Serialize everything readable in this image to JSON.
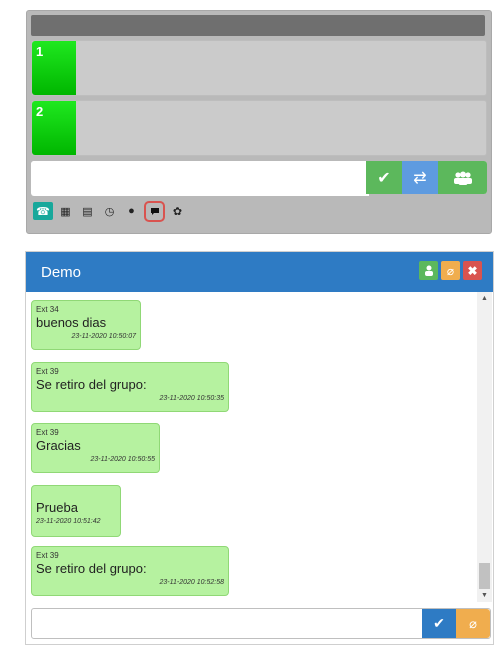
{
  "softphone": {
    "lines": [
      {
        "number": "1"
      },
      {
        "number": "2"
      }
    ],
    "dial_input": {
      "value": "",
      "placeholder": ""
    },
    "buttons": {
      "accept_icon": "checkmark-icon",
      "transfer_icon": "transfer-icon",
      "conference_icon": "users-icon"
    },
    "toolbar": [
      "phone-icon",
      "keypad-icon",
      "contacts-icon",
      "history-icon",
      "globe-icon",
      "chat-icon",
      "settings-icon"
    ],
    "active_tool": "chat-icon"
  },
  "chat": {
    "title": "Demo",
    "header_buttons": [
      "user-icon",
      "attach-icon",
      "close-icon"
    ],
    "messages": [
      {
        "sender": "Ext 34",
        "text": "buenos dias",
        "time": "23-11-2020 10:50:07"
      },
      {
        "sender": "Ext 39",
        "text": "Se retiro del grupo:",
        "time": "23-11-2020 10:50:35"
      },
      {
        "sender": "Ext 39",
        "text": "Gracias",
        "time": "23-11-2020 10:50:55"
      },
      {
        "sender": "",
        "text": "Prueba",
        "time": "23-11-2020 10:51:42"
      },
      {
        "sender": "Ext 39",
        "text": "Se retiro del grupo:",
        "time": "23-11-2020 10:52:58"
      }
    ],
    "composer": {
      "value": "",
      "placeholder": ""
    }
  },
  "colors": {
    "header_blue": "#2e7bc4",
    "bubble_green": "#b6f2a0",
    "line_green": "#00c800",
    "success": "#5cb85c",
    "warning": "#f0ad4e",
    "danger": "#d9534f"
  }
}
